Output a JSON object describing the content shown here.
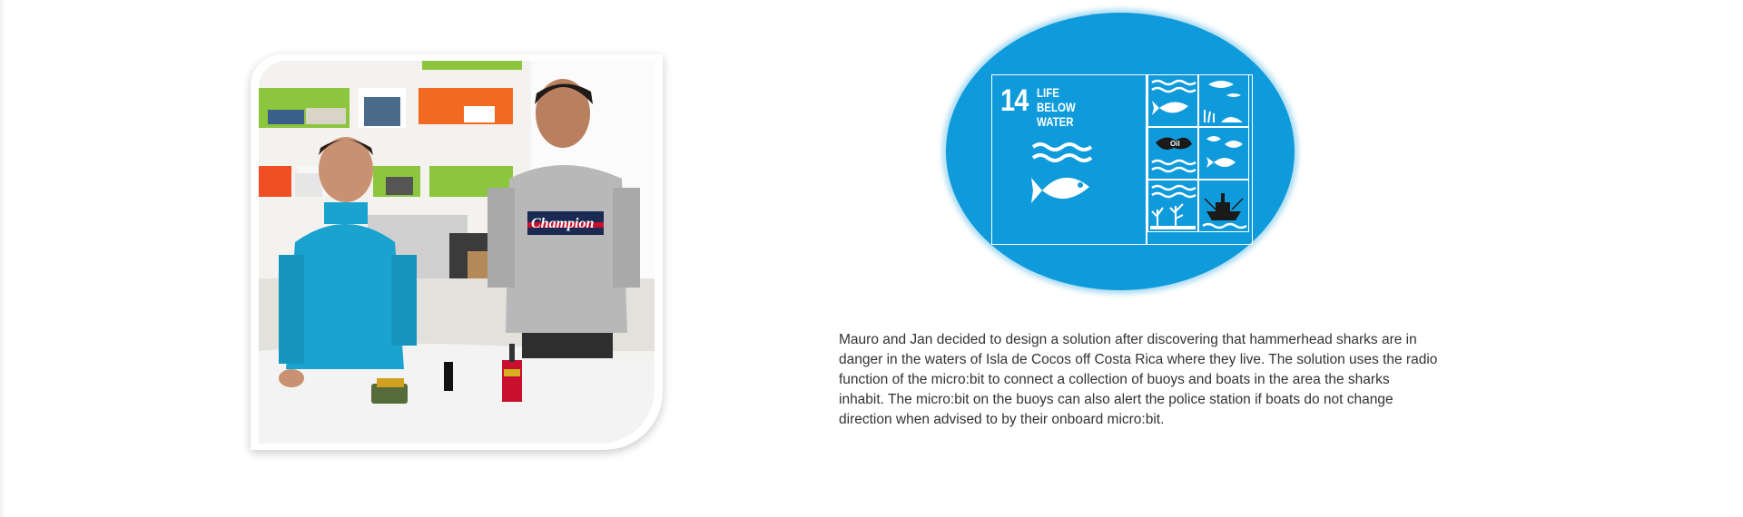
{
  "photo": {
    "alt": "Two students standing at a white table with their micro:bit buoy and boat prototypes",
    "shirt_text": "Champion"
  },
  "sdg_badge": {
    "number": "14",
    "title": "LIFE BELOW WATER",
    "cell_label": "Oil",
    "colors": {
      "background": "#0f9bdb",
      "foreground": "#ffffff"
    },
    "icons": [
      "waves-fish-icon",
      "fish-jellyfish-icon",
      "oil-spill-icon",
      "fish-school-icon",
      "waves-coral-icon",
      "ship-icon"
    ]
  },
  "description": {
    "text": "Mauro and Jan decided to design a solution after discovering that hammerhead sharks are in danger in the waters of Isla de Cocos off Costa Rica where they live. The solution uses the radio function of the micro:bit to connect a collection of buoys and boats in the area the sharks inhabit. The micro:bit on the buoys can also alert the police station if boats do not change direction when advised to by their onboard micro:bit."
  }
}
